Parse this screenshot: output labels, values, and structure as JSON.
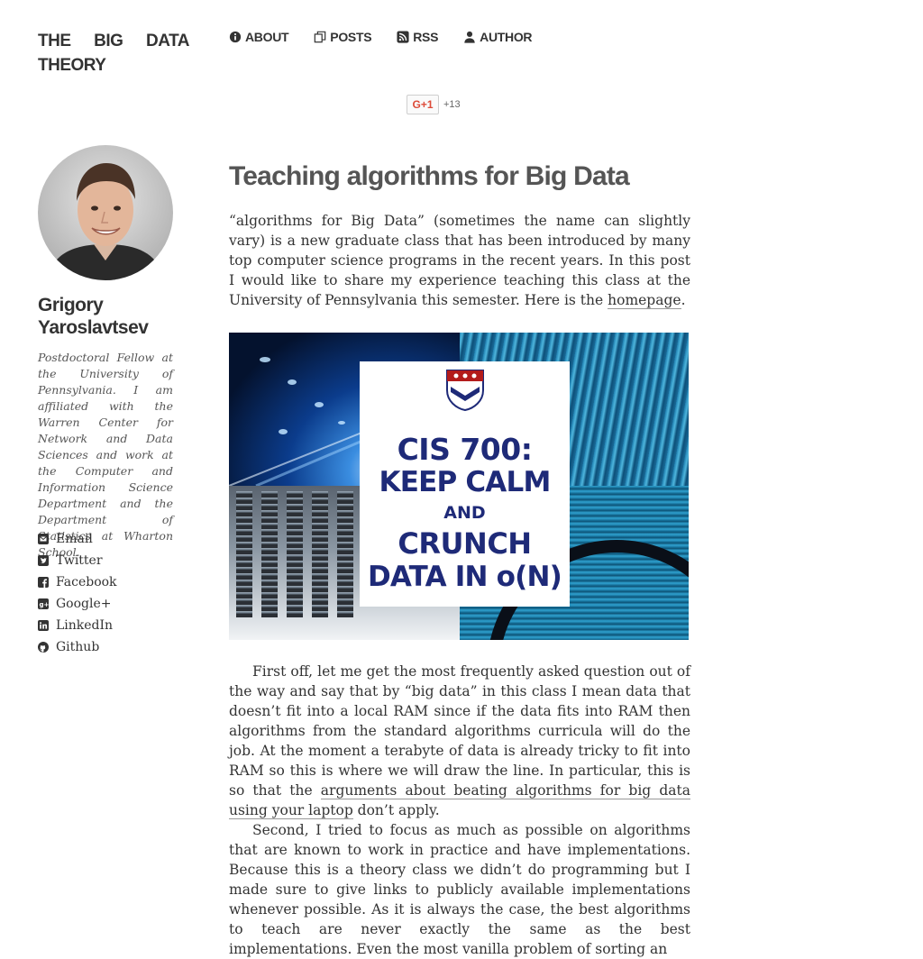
{
  "site": {
    "title_words": [
      "THE",
      "BIG",
      "DATA"
    ],
    "title_last": "THEORY"
  },
  "nav": [
    {
      "label": "ABOUT",
      "icon": "info-icon"
    },
    {
      "label": "POSTS",
      "icon": "posts-icon"
    },
    {
      "label": "RSS",
      "icon": "rss-icon"
    },
    {
      "label": "AUTHOR",
      "icon": "user-icon"
    }
  ],
  "gplus": {
    "label": "G+1",
    "count": "+13"
  },
  "sidebar": {
    "name": "Grigory Yaroslavtsev",
    "bio": "Postdoctoral Fellow at the University of Pennsylvania. I am affiliated with the Warren Center for Network and Data Sciences and work at the Computer and Information Science Department and the Department of Statistics at Wharton School.",
    "social": [
      {
        "label": "Email",
        "icon": "email-icon"
      },
      {
        "label": "Twitter",
        "icon": "twitter-icon"
      },
      {
        "label": "Facebook",
        "icon": "facebook-icon"
      },
      {
        "label": "Google+",
        "icon": "google-plus-icon"
      },
      {
        "label": "LinkedIn",
        "icon": "linkedin-icon"
      },
      {
        "label": "Github",
        "icon": "github-icon"
      }
    ]
  },
  "post": {
    "title": "Teaching algorithms for Big Data",
    "intro_before": "“algorithms for Big Data” (sometimes the name can slightly vary) is a new graduate class that has been introduced by many top computer science programs in the recent years. In this post I would like to share my experience teaching this class at the University of Pennsylvania this semester. Here is the ",
    "intro_link": "homepage",
    "intro_after": ".",
    "banner": {
      "line1": "CIS 700:",
      "line2": "KEEP CALM",
      "line3": "AND",
      "line4": "CRUNCH",
      "line5": "DATA IN o(N)"
    },
    "p1_before": "First off, let me get the most frequently asked question out of the way and say that by “big data” in this class I mean data that doesn’t fit into a local RAM since if the data fits into RAM then algorithms from the standard algorithms curricula will do the job. At the moment a terabyte of data is already tricky to fit into RAM so this is where we will draw the line. In particular, this is so that the ",
    "p1_link": "arguments about beating algorithms for big data using your laptop",
    "p1_after": " don’t apply.",
    "p2": "Second, I tried to focus as much as possible on algorithms that are known to work in practice and have implementations. Because this is a theory class we didn’t do programming but I made sure to give links to publicly available implementations whenever possible. As it is always the case, the best algorithms to teach are never exactly the same as the best implementations. Even the most vanilla problem of sorting an"
  },
  "colors": {
    "text": "#333333",
    "title": "#555555",
    "poster_text": "#1e2a78",
    "gplus_red": "#dd4b39"
  }
}
